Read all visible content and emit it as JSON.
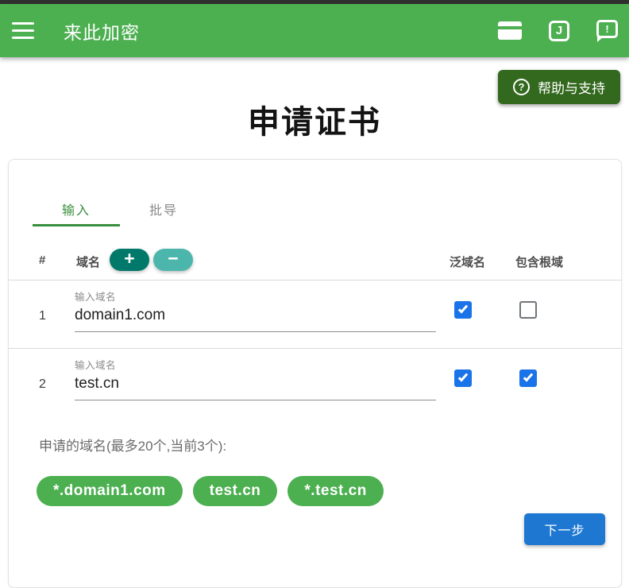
{
  "app_bar": {
    "title": "来此加密",
    "icons": [
      {
        "name": "credit-card"
      },
      {
        "name": "j-badge",
        "glyph": "J"
      },
      {
        "name": "feedback",
        "glyph": "!"
      }
    ]
  },
  "help": {
    "icon_glyph": "?",
    "label": "帮助与支持"
  },
  "page": {
    "title": "申请证书"
  },
  "tabs": [
    {
      "label": "输入",
      "active": true
    },
    {
      "label": "批导",
      "active": false
    }
  ],
  "table": {
    "headers": {
      "index": "#",
      "domain": "域名",
      "wildcard": "泛域名",
      "include_root": "包含根域"
    },
    "add_button": "+",
    "remove_button": "−",
    "input_label": "输入域名",
    "rows": [
      {
        "index": "1",
        "value": "domain1.com",
        "wildcard": true,
        "include_root": false
      },
      {
        "index": "2",
        "value": "test.cn",
        "wildcard": true,
        "include_root": true
      }
    ]
  },
  "summary": {
    "text": "申请的域名(最多20个,当前3个):",
    "chips": [
      "*.domain1.com",
      "test.cn",
      "*.test.cn"
    ]
  },
  "next_button": "下一步",
  "colors": {
    "brand_green": "#4caf50",
    "dark_green": "#33691e",
    "tab_green": "#388e3c",
    "teal_dark": "#00796b",
    "teal_light": "#4db6ac",
    "checkbox_blue": "#1a73e8",
    "button_blue": "#1e78d2",
    "chip_green": "#4caf50"
  }
}
